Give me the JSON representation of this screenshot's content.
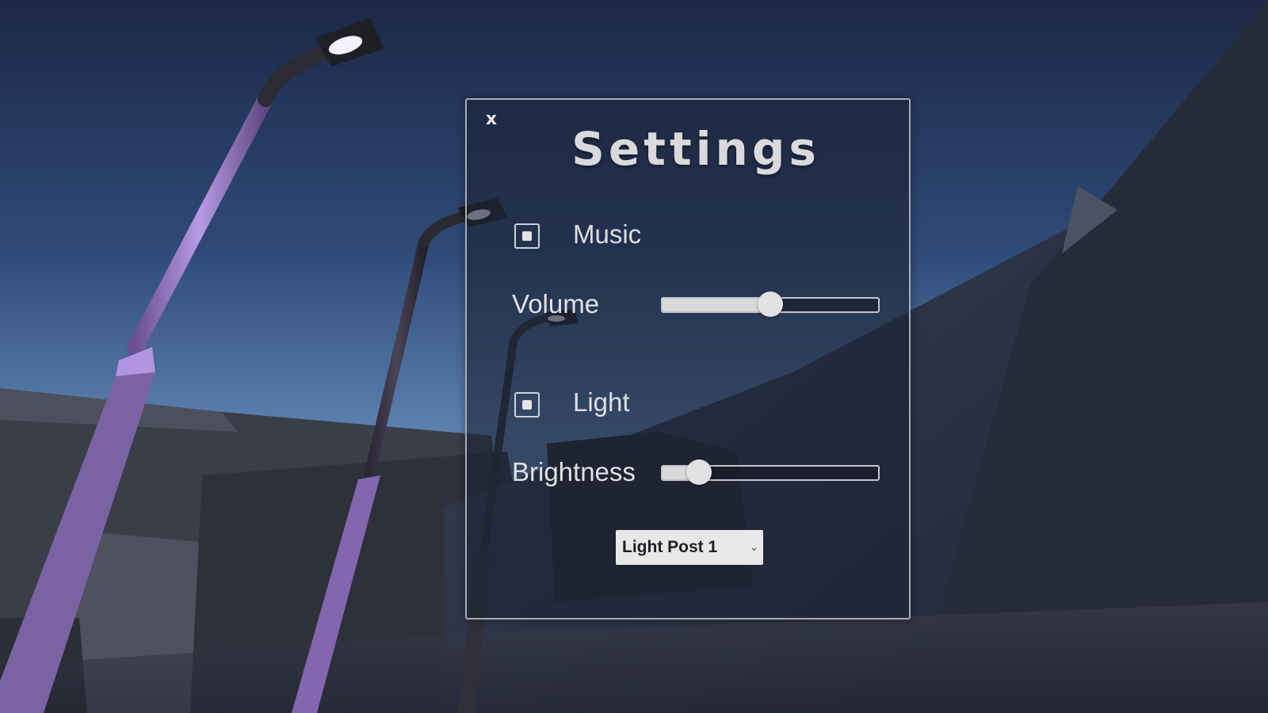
{
  "settings": {
    "close_label": "x",
    "title": "Settings",
    "music": {
      "label": "Music",
      "checked": true
    },
    "volume": {
      "label": "Volume",
      "value": 0.5
    },
    "light": {
      "label": "Light",
      "checked": true
    },
    "brightness": {
      "label": "Brightness",
      "value": 0.17
    },
    "light_post_select": {
      "selected": "Light Post 1"
    }
  },
  "icons": {
    "close": "close-icon",
    "checkbox_mark": "checkbox-checked-icon",
    "dropdown_arrow": "chevron-down-icon"
  },
  "colors": {
    "sky_top": "#1d2a48",
    "sky_bottom": "#5a7fae",
    "lamp_pole": "#8c6fb5",
    "panel_border": "#a9adb6"
  }
}
